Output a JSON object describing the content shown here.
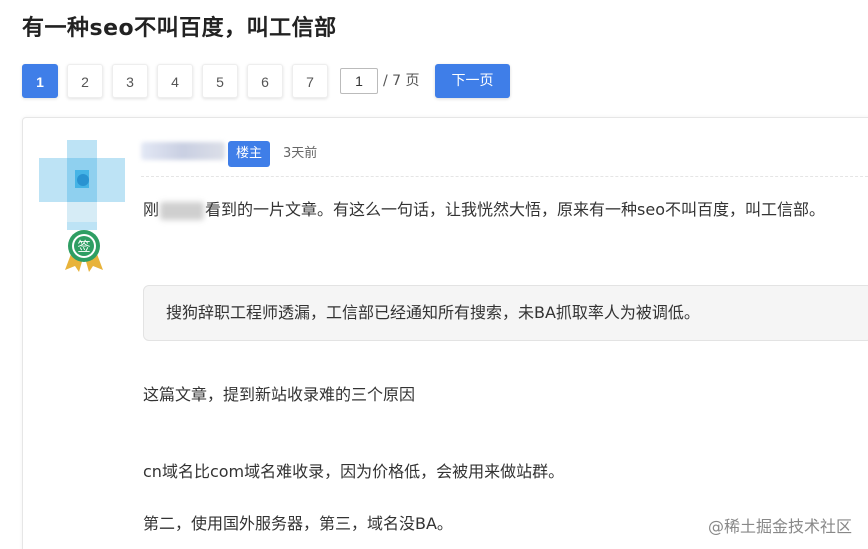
{
  "thread": {
    "title": "有一种seo不叫百度，叫工信部"
  },
  "pagination": {
    "pages": [
      "1",
      "2",
      "3",
      "4",
      "5",
      "6",
      "7"
    ],
    "current_page_value": "1",
    "total_label": "/ 7 页",
    "next_label": "下一页"
  },
  "post": {
    "author_badge_label": "楼主",
    "time_ago": "3天前",
    "badge_text": "签",
    "paragraphs": {
      "p1_prefix": "刚",
      "p1_suffix": "看到的一片文章。有这么一句话，让我恍然大悟，原来有一种seo不叫百度，叫工信部。",
      "quote": "搜狗辞职工程师透漏，工信部已经通知所有搜索，未BA抓取率人为被调低。",
      "p2": "这篇文章，提到新站收录难的三个原因",
      "p3": "cn域名比com域名难收录，因为价格低，会被用来做站群。",
      "p4": "第二，使用国外服务器，第三，域名没BA。"
    }
  },
  "watermark": "@稀土掘金技术社区",
  "colors": {
    "accent": "#3f7ee8",
    "badge_green": "#2e9e63",
    "badge_gold": "#e8b33a"
  }
}
